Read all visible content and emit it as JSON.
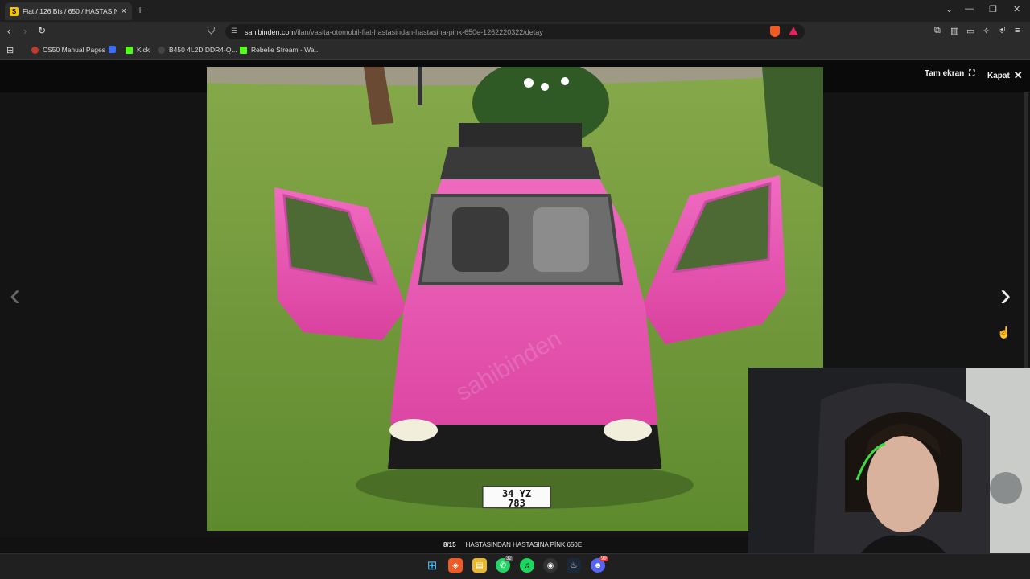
{
  "browser": {
    "tab": {
      "favicon": "S",
      "title": "Fiat / 126 Bis / 650 / HASTASIND"
    },
    "address": {
      "host": "sahibinden.com",
      "path": "/ilan/vasita-otomobil-fiat-hastasindan-hastasina-pink-650e-1262220322/detay"
    },
    "bookmarks": [
      {
        "label": "CS50 Manual Pages",
        "icon_color": "#c0392b"
      },
      {
        "label": "",
        "icon_color": "#3b6ef5"
      },
      {
        "label": "Kick",
        "icon_color": "#53fc18"
      },
      {
        "label": "B450 4L2D DDR4-Q...",
        "icon_color": "#444444"
      },
      {
        "label": "Rebelie Stream - Wa...",
        "icon_color": "#53fc18"
      }
    ]
  },
  "viewer": {
    "fullscreen_label": "Tam ekran",
    "close_label": "Kapat",
    "watermark": "sahibinden",
    "counter": "8/15",
    "caption": "HASTASINDAN HASTASINA PİNK 650E",
    "plate_line1": "34 YZ",
    "plate_line2": "783"
  },
  "taskbar": {
    "whatsapp_badge": "32",
    "discord_badge": "99"
  },
  "colors": {
    "car_pink": "#e855b4",
    "grass": "#6f9a3a",
    "accent": "#f05a24"
  }
}
